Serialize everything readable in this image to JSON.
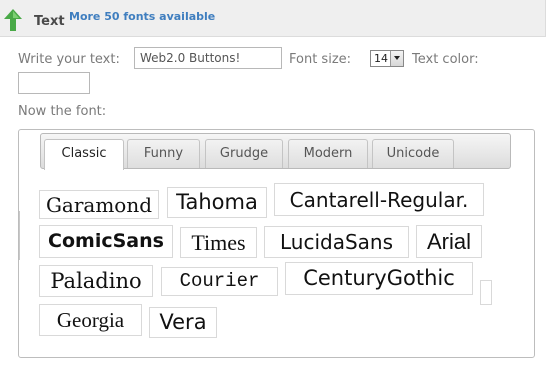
{
  "header": {
    "title": "Text",
    "link": "More 50 fonts available",
    "arrow_color": "#49a947"
  },
  "form": {
    "text_label": "Write your text:",
    "text_value": "Web2.0 Buttons!",
    "size_label": "Font size:",
    "size_value": "14",
    "color_label": "Text color:",
    "color_value": ""
  },
  "font_section": {
    "label": "Now the font:",
    "tabs": [
      "Classic",
      "Funny",
      "Grudge",
      "Modern",
      "Unicode"
    ],
    "active_tab": "Classic",
    "fonts": [
      "Garamond",
      "Tahoma",
      "Cantarell-Regular.",
      "ComicSans",
      "Times",
      "LucidaSans",
      "Arial",
      "Paladino",
      "Courier",
      "CenturyGothic",
      "Georgia",
      "Vera"
    ]
  }
}
